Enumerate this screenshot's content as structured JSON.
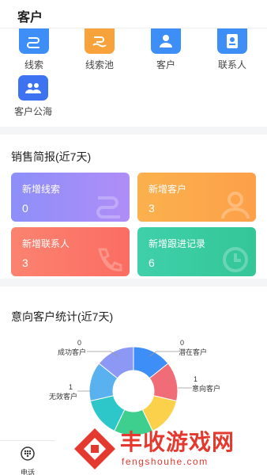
{
  "header": {
    "title": "客户"
  },
  "menu": {
    "items": [
      {
        "label": "线索",
        "icon": "clue-icon",
        "color": "#3d8ef7"
      },
      {
        "label": "线索池",
        "icon": "clue-pool-icon",
        "color": "#f7a23a"
      },
      {
        "label": "客户",
        "icon": "customer-icon",
        "color": "#3d8ef7"
      },
      {
        "label": "联系人",
        "icon": "contact-card-icon",
        "color": "#3d8ef7"
      },
      {
        "label": "客户公海",
        "icon": "customer-sea-icon",
        "color": "#3d72f0"
      }
    ]
  },
  "sales": {
    "title": "销售简报(近7天)",
    "stats": [
      {
        "label": "新增线索",
        "value": "0",
        "from": "#8d8ff9",
        "to": "#b08df7"
      },
      {
        "label": "新增客户",
        "value": "3",
        "from": "#fbb14d",
        "to": "#fca04a"
      },
      {
        "label": "新增联系人",
        "value": "3",
        "from": "#fb8370",
        "to": "#fb6d62"
      },
      {
        "label": "新增跟进记录",
        "value": "6",
        "from": "#3fd0aa",
        "to": "#34c697"
      }
    ]
  },
  "intent": {
    "title": "意向客户统计(近7天)"
  },
  "chart_data": {
    "type": "pie",
    "labels": [
      {
        "name": "成功客户",
        "value": "0"
      },
      {
        "name": "潜在客户",
        "value": "0"
      },
      {
        "name": "无效客户",
        "value": "1"
      },
      {
        "name": "意向客户",
        "value": "1"
      }
    ],
    "ring_colors": [
      "#3d8ef7",
      "#f06d77",
      "#fbd14b",
      "#3ecf8e",
      "#2ec7c9",
      "#5ab1ef",
      "#8d98f5"
    ]
  },
  "tabbar": {
    "label": "电话",
    "icon": "phone-keypad-icon"
  },
  "watermark": {
    "cn": "丰收游戏网",
    "en": "fengshouhe.com"
  }
}
